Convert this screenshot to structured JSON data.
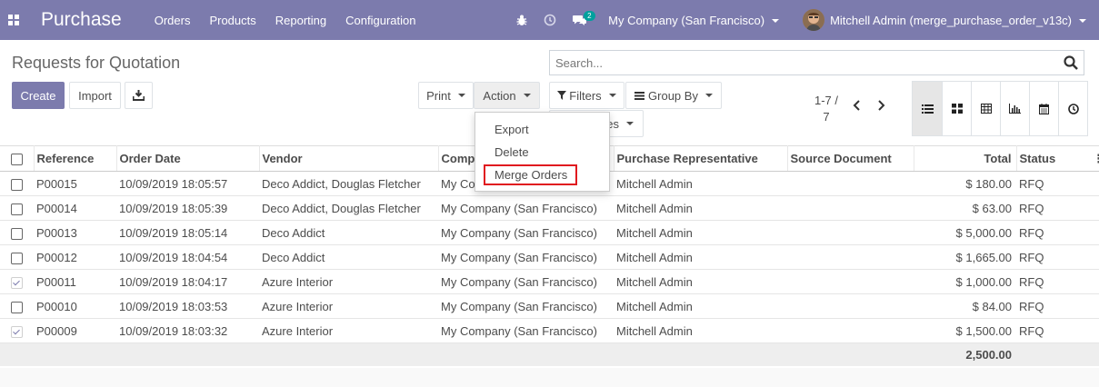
{
  "navbar": {
    "app_title": "Purchase",
    "menu": [
      "Orders",
      "Products",
      "Reporting",
      "Configuration"
    ],
    "chat_badge": "2",
    "company": "My Company (San Francisco)",
    "user": "Mitchell Admin (merge_purchase_order_v13c)"
  },
  "control_panel": {
    "breadcrumb": "Requests for Quotation",
    "create_label": "Create",
    "import_label": "Import",
    "print_label": "Print",
    "action_label": "Action",
    "filters_label": "Filters",
    "groupby_label": "Group By",
    "favorites_partial": "es",
    "search_placeholder": "Search...",
    "pager_line1": "1-7 /",
    "pager_line2": "7"
  },
  "action_menu": {
    "items": [
      "Export",
      "Delete",
      "Merge Orders"
    ],
    "highlighted": "Merge Orders",
    "highlight_color": "#e0191f"
  },
  "table": {
    "columns": [
      "Reference",
      "Order Date",
      "Vendor",
      "Company",
      "Purchase Representative",
      "Source Document",
      "Total",
      "Status"
    ],
    "rows": [
      {
        "checked": false,
        "ref": "P00015",
        "date": "10/09/2019 18:05:57",
        "vendor": "Deco Addict, Douglas Fletcher",
        "company": "My Company (San Francisco)",
        "rep": "Mitchell Admin",
        "source": "",
        "total": "$ 180.00",
        "status": "RFQ"
      },
      {
        "checked": false,
        "ref": "P00014",
        "date": "10/09/2019 18:05:39",
        "vendor": "Deco Addict, Douglas Fletcher",
        "company": "My Company (San Francisco)",
        "rep": "Mitchell Admin",
        "source": "",
        "total": "$ 63.00",
        "status": "RFQ"
      },
      {
        "checked": false,
        "ref": "P00013",
        "date": "10/09/2019 18:05:14",
        "vendor": "Deco Addict",
        "company": "My Company (San Francisco)",
        "rep": "Mitchell Admin",
        "source": "",
        "total": "$ 5,000.00",
        "status": "RFQ"
      },
      {
        "checked": false,
        "ref": "P00012",
        "date": "10/09/2019 18:04:54",
        "vendor": "Deco Addict",
        "company": "My Company (San Francisco)",
        "rep": "Mitchell Admin",
        "source": "",
        "total": "$ 1,665.00",
        "status": "RFQ"
      },
      {
        "checked": true,
        "ref": "P00011",
        "date": "10/09/2019 18:04:17",
        "vendor": "Azure Interior",
        "company": "My Company (San Francisco)",
        "rep": "Mitchell Admin",
        "source": "",
        "total": "$ 1,000.00",
        "status": "RFQ"
      },
      {
        "checked": false,
        "ref": "P00010",
        "date": "10/09/2019 18:03:53",
        "vendor": "Azure Interior",
        "company": "My Company (San Francisco)",
        "rep": "Mitchell Admin",
        "source": "",
        "total": "$ 84.00",
        "status": "RFQ"
      },
      {
        "checked": true,
        "ref": "P00009",
        "date": "10/09/2019 18:03:32",
        "vendor": "Azure Interior",
        "company": "My Company (San Francisco)",
        "rep": "Mitchell Admin",
        "source": "",
        "total": "$ 1,500.00",
        "status": "RFQ"
      }
    ],
    "footer_total": "2,500.00"
  },
  "colors": {
    "brand": "#7c7bad",
    "badge": "#00a09d"
  }
}
